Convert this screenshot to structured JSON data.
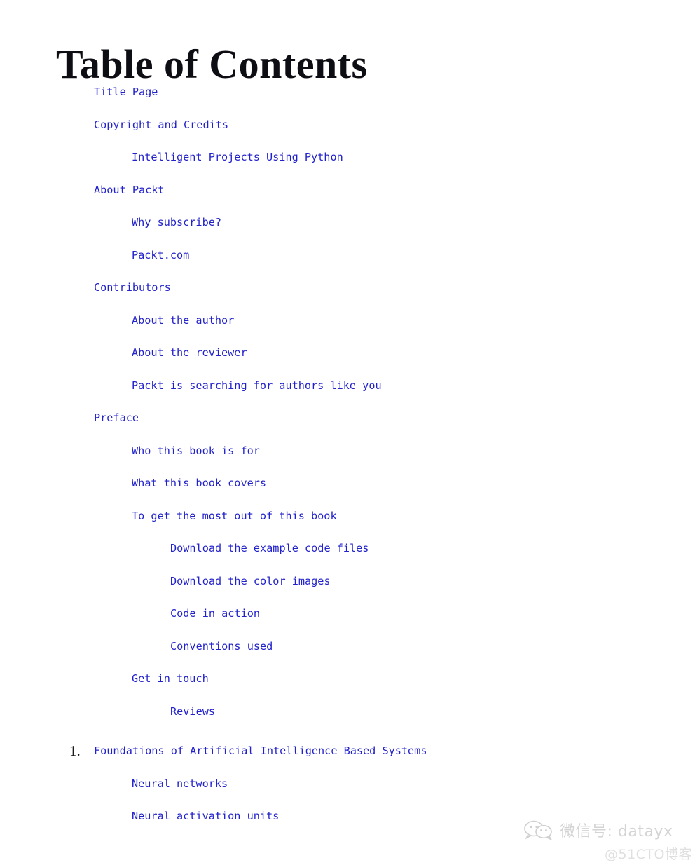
{
  "page": {
    "title": "Table of Contents"
  },
  "toc": {
    "entries": [
      {
        "label": "Title Page",
        "level": 0,
        "number": null
      },
      {
        "label": "Copyright and Credits",
        "level": 0,
        "number": null
      },
      {
        "label": "Intelligent Projects Using Python",
        "level": 1,
        "number": null
      },
      {
        "label": "About Packt",
        "level": 0,
        "number": null
      },
      {
        "label": "Why subscribe?",
        "level": 1,
        "number": null
      },
      {
        "label": "Packt.com",
        "level": 1,
        "number": null
      },
      {
        "label": "Contributors",
        "level": 0,
        "number": null
      },
      {
        "label": "About the author",
        "level": 1,
        "number": null
      },
      {
        "label": "About the reviewer",
        "level": 1,
        "number": null
      },
      {
        "label": "Packt is searching for authors like you",
        "level": 1,
        "number": null
      },
      {
        "label": "Preface",
        "level": 0,
        "number": null
      },
      {
        "label": "Who this book is for",
        "level": 1,
        "number": null
      },
      {
        "label": "What this book covers",
        "level": 1,
        "number": null
      },
      {
        "label": "To get the most out of this book",
        "level": 1,
        "number": null
      },
      {
        "label": "Download the example code files",
        "level": 2,
        "number": null
      },
      {
        "label": "Download the color images",
        "level": 2,
        "number": null
      },
      {
        "label": "Code in action",
        "level": 2,
        "number": null
      },
      {
        "label": "Conventions used",
        "level": 2,
        "number": null
      },
      {
        "label": "Get in touch",
        "level": 1,
        "number": null
      },
      {
        "label": "Reviews",
        "level": 2,
        "number": null
      },
      {
        "label": "Foundations of Artificial Intelligence Based Systems",
        "level": 0,
        "number": "1."
      },
      {
        "label": "Neural networks",
        "level": 1,
        "number": null
      },
      {
        "label": "Neural activation units",
        "level": 1,
        "number": null
      }
    ],
    "link_color": "#2222cc",
    "number_color": "#1a1a1a"
  },
  "watermark": {
    "icon": "wechat-icon",
    "text": "微信号: datayx",
    "subtext": "@51CTO博客"
  }
}
